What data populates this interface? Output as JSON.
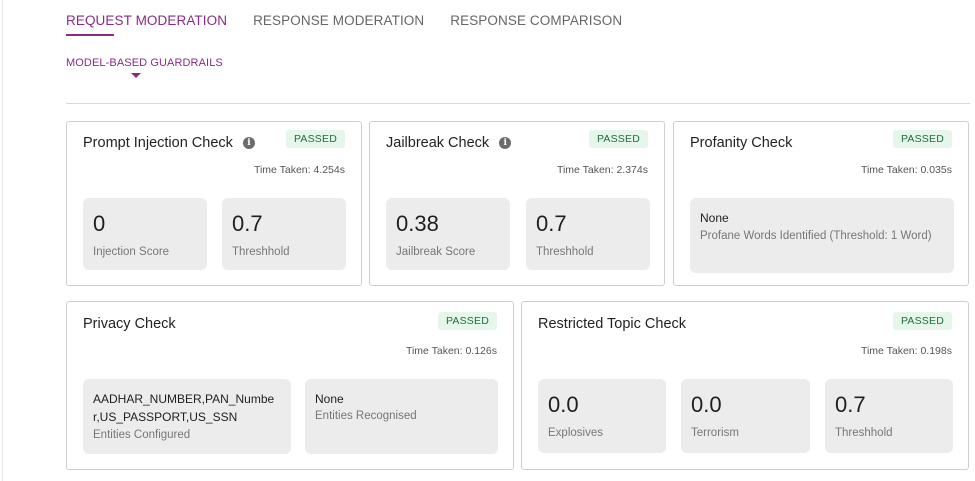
{
  "tabs": {
    "request_moderation": "REQUEST MODERATION",
    "response_moderation": "RESPONSE MODERATION",
    "response_comparison": "RESPONSE COMPARISON"
  },
  "subtab": "MODEL-BASED GUARDRAILS",
  "cards": {
    "prompt_injection": {
      "title": "Prompt Injection Check",
      "status": "PASSED",
      "time": "Time Taken: 4.254s",
      "score_value": "0",
      "score_label": "Injection Score",
      "threshold_value": "0.7",
      "threshold_label": "Threshhold"
    },
    "jailbreak": {
      "title": "Jailbreak Check",
      "status": "PASSED",
      "time": "Time Taken: 2.374s",
      "score_value": "0.38",
      "score_label": "Jailbreak Score",
      "threshold_value": "0.7",
      "threshold_label": "Threshhold"
    },
    "profanity": {
      "title": "Profanity Check",
      "status": "PASSED",
      "time": "Time Taken: 0.035s",
      "words_value": "None",
      "words_label": "Profane Words Identified (Threshold: 1 Word)"
    },
    "privacy": {
      "title": "Privacy Check",
      "status": "PASSED",
      "time": "Time Taken: 0.126s",
      "configured_line1": "AADHAR_NUMBER,PAN_Numbe",
      "configured_line2": "r,US_PASSPORT,US_SSN",
      "configured_label": "Entities Configured",
      "recognised_value": "None",
      "recognised_label": "Entities Recognised"
    },
    "restricted_topic": {
      "title": "Restricted Topic Check",
      "status": "PASSED",
      "time": "Time Taken: 0.198s",
      "explosives_value": "0.0",
      "explosives_label": "Explosives",
      "terrorism_value": "0.0",
      "terrorism_label": "Terrorism",
      "threshold_value": "0.7",
      "threshold_label": "Threshhold"
    }
  },
  "colors": {
    "accent": "#8a2b87",
    "passed_bg": "#e5f6ea",
    "passed_text": "#1f6f3c",
    "box_bg": "#ececec"
  },
  "icons": {
    "info": "info-icon"
  }
}
